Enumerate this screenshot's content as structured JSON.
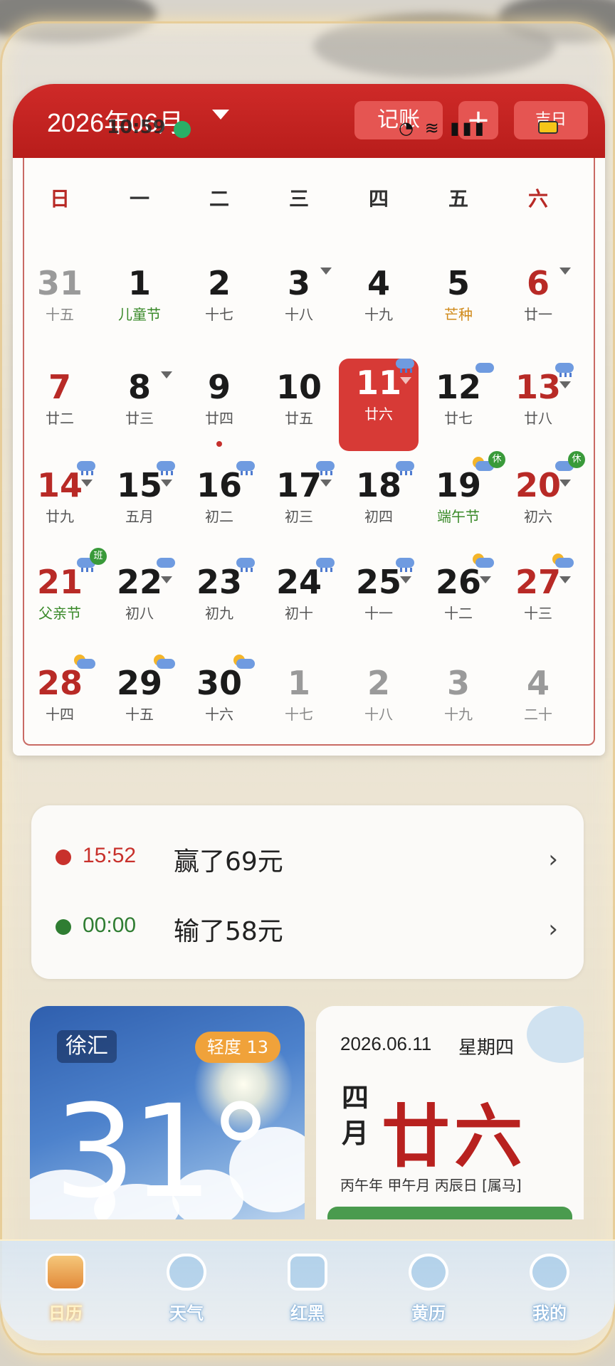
{
  "status_bar": {
    "time": "10:59"
  },
  "header": {
    "month_title": "2026年06月",
    "buttons": {
      "bookkeeping": "记账",
      "add": "+",
      "more": "吉日"
    }
  },
  "weekdays": [
    "日",
    "一",
    "二",
    "三",
    "四",
    "五",
    "六"
  ],
  "calendar": [
    [
      {
        "day": "31",
        "lunar": "十五",
        "dim": true
      },
      {
        "day": "1",
        "lunar": "儿童节",
        "fest": "green"
      },
      {
        "day": "2",
        "lunar": "十七"
      },
      {
        "day": "3",
        "lunar": "十八",
        "tri": true
      },
      {
        "day": "4",
        "lunar": "十九"
      },
      {
        "day": "5",
        "lunar": "芒种",
        "fest": "orange"
      },
      {
        "day": "6",
        "lunar": "廿一",
        "red": true,
        "tri": true
      }
    ],
    [
      {
        "day": "7",
        "lunar": "廿二",
        "red": true
      },
      {
        "day": "8",
        "lunar": "廿三",
        "tri": true
      },
      {
        "day": "9",
        "lunar": "廿四",
        "dot": true
      },
      {
        "day": "10",
        "lunar": "廿五"
      },
      {
        "day": "11",
        "lunar": "廿六",
        "today": true,
        "weather": "rain",
        "tri": true
      },
      {
        "day": "12",
        "lunar": "廿七",
        "weather": "cloud"
      },
      {
        "day": "13",
        "lunar": "廿八",
        "red": true,
        "weather": "rain",
        "tri": true
      }
    ],
    [
      {
        "day": "14",
        "lunar": "廿九",
        "red": true,
        "weather": "rain",
        "tri": true
      },
      {
        "day": "15",
        "lunar": "五月",
        "weather": "rain",
        "tri": true
      },
      {
        "day": "16",
        "lunar": "初二",
        "weather": "rain"
      },
      {
        "day": "17",
        "lunar": "初三",
        "weather": "rain",
        "tri": true
      },
      {
        "day": "18",
        "lunar": "初四",
        "weather": "rain"
      },
      {
        "day": "19",
        "lunar": "端午节",
        "fest": "green",
        "weather": "sun",
        "badge": "休"
      },
      {
        "day": "20",
        "lunar": "初六",
        "red": true,
        "weather": "cloud",
        "badge": "休",
        "tri": true
      }
    ],
    [
      {
        "day": "21",
        "lunar": "父亲节",
        "fest": "green",
        "red": true,
        "weather": "rain",
        "badge": "班"
      },
      {
        "day": "22",
        "lunar": "初八",
        "weather": "cloud",
        "tri": true
      },
      {
        "day": "23",
        "lunar": "初九",
        "weather": "rain"
      },
      {
        "day": "24",
        "lunar": "初十",
        "weather": "rain"
      },
      {
        "day": "25",
        "lunar": "十一",
        "weather": "rain",
        "tri": true
      },
      {
        "day": "26",
        "lunar": "十二",
        "weather": "sun",
        "tri": true
      },
      {
        "day": "27",
        "lunar": "十三",
        "red": true,
        "weather": "sun",
        "tri": true
      }
    ],
    [
      {
        "day": "28",
        "lunar": "十四",
        "red": true,
        "weather": "sun"
      },
      {
        "day": "29",
        "lunar": "十五",
        "weather": "sun"
      },
      {
        "day": "30",
        "lunar": "十六",
        "weather": "sun"
      },
      {
        "day": "1",
        "lunar": "十七",
        "dim": true
      },
      {
        "day": "2",
        "lunar": "十八",
        "dim": true
      },
      {
        "day": "3",
        "lunar": "十九",
        "dim": true
      },
      {
        "day": "4",
        "lunar": "二十",
        "dim": true
      }
    ]
  ],
  "records": [
    {
      "time": "15:52",
      "text": "赢了69元",
      "color": "#c8312c"
    },
    {
      "time": "00:00",
      "text": "输了58元",
      "color": "#2f7d32"
    }
  ],
  "weather": {
    "location": "徐汇",
    "aqi": "轻度 13",
    "temperature": "31°"
  },
  "almanac": {
    "date": "2026.06.11",
    "weekday": "星期四",
    "lunar_month": "四月",
    "lunar_day": "廿六",
    "ganzhi": "丙午年 甲午月 丙辰日 [属马]"
  },
  "nav": [
    {
      "label": "日历",
      "icon": "calendar-icon",
      "active": true
    },
    {
      "label": "天气",
      "icon": "cloud-icon"
    },
    {
      "label": "红黑",
      "icon": "book-icon"
    },
    {
      "label": "黄历",
      "icon": "yin-yang-icon"
    },
    {
      "label": "我的",
      "icon": "user-icon"
    }
  ],
  "colors": {
    "brand_red": "#cf2a28",
    "today_bg": "#d73a36",
    "festival_green": "#3a8a2a",
    "solar_term_orange": "#d08a1a"
  }
}
